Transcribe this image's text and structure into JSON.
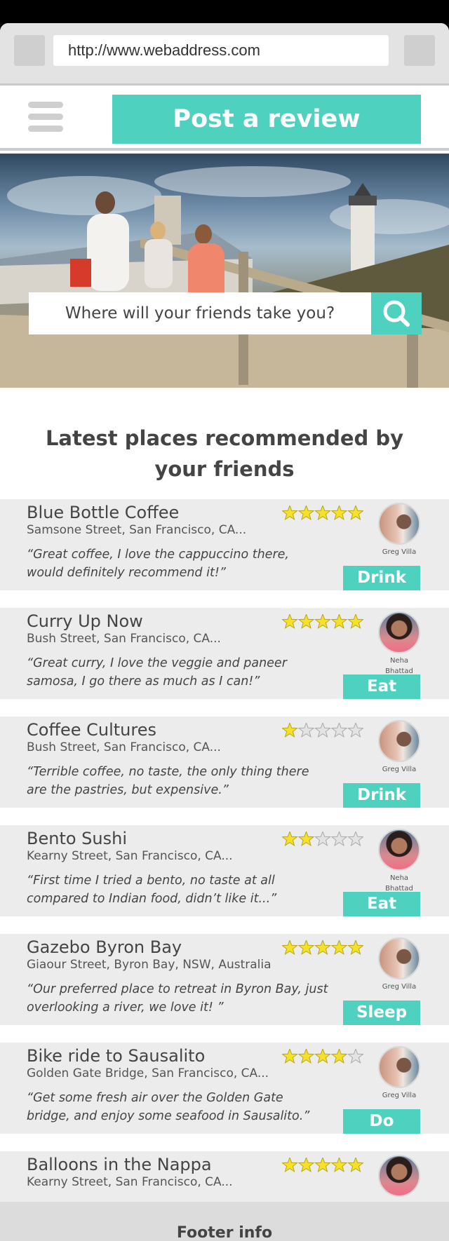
{
  "browser": {
    "url": "http://www.webaddress.com"
  },
  "header": {
    "post_review_label": "Post a review"
  },
  "hero": {
    "search_placeholder": "Where will your friends take you?"
  },
  "section": {
    "title": "Latest places recommended by your friends"
  },
  "colors": {
    "accent": "#4fd1bf",
    "star_filled": "#f5e02a",
    "card_bg": "#ececec"
  },
  "reviews": [
    {
      "name": "Blue Bottle Coffee",
      "address": "Samsone Street, San Francisco, CA...",
      "quote": "“Great coffee, I love the cappuccino there, would definitely recommend it!”",
      "rating": 5,
      "author": "Greg Villa",
      "avatar": "greg",
      "category": "Drink"
    },
    {
      "name": "Curry Up Now",
      "address": "Bush Street, San Francisco, CA...",
      "quote": "“Great curry, I love the veggie and paneer samosa, I go there as much as I can!”",
      "rating": 5,
      "author": "Neha Bhattad",
      "avatar": "neha",
      "category": "Eat"
    },
    {
      "name": "Coffee Cultures",
      "address": "Bush Street, San Francisco, CA...",
      "quote": "“Terrible coffee, no taste, the only thing there are the pastries, but expensive.”",
      "rating": 1,
      "author": "Greg Villa",
      "avatar": "greg",
      "category": "Drink"
    },
    {
      "name": "Bento Sushi",
      "address": "Kearny Street, San Francisco, CA...",
      "quote": "“First time I tried a bento, no taste at all compared to Indian food, didn’t like it...”",
      "rating": 2,
      "author": "Neha Bhattad",
      "avatar": "neha",
      "category": "Eat"
    },
    {
      "name": "Gazebo Byron Bay",
      "address": "Giaour Street, Byron Bay, NSW, Australia",
      "quote": "“Our preferred place to retreat in Byron Bay, just overlooking a river, we love it! ”",
      "rating": 5,
      "author": "Greg Villa",
      "avatar": "greg",
      "category": "Sleep"
    },
    {
      "name": "Bike ride to Sausalito",
      "address": "Golden Gate Bridge, San Francisco, CA...",
      "quote": "“Get some fresh air over the Golden Gate bridge, and enjoy some seafood in Sausalito.”",
      "rating": 4,
      "author": "Greg Villa",
      "avatar": "greg",
      "category": "Do"
    },
    {
      "name": "Balloons in the Nappa",
      "address": "Kearny Street, San Francisco, CA...",
      "quote": "",
      "rating": 5,
      "author": "",
      "avatar": "neha",
      "category": ""
    }
  ],
  "footer": {
    "label": "Footer info"
  }
}
